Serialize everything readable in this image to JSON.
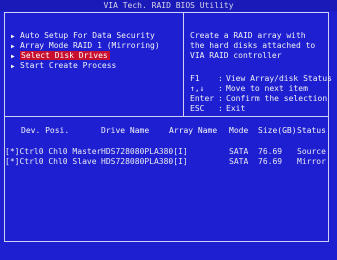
{
  "title": "VIA Tech. RAID BIOS Utility",
  "menu": {
    "items": [
      {
        "label": "Auto Setup For Data Security",
        "selected": false
      },
      {
        "label": "Array Mode RAID 1 (Mirroring)",
        "selected": false
      },
      {
        "label": "Select Disk Drives",
        "selected": true
      },
      {
        "label": "Start Create Process",
        "selected": false
      }
    ],
    "bullet_icon": "triangle-right-icon",
    "highlight_color": "#c8102e"
  },
  "help": {
    "lines": [
      "Create a RAID array with",
      "the hard disks attached to",
      "VIA RAID controller"
    ]
  },
  "keys": [
    {
      "key": "F1",
      "desc": "View Array/disk Status"
    },
    {
      "key": "↑,↓",
      "desc": "Move to next item"
    },
    {
      "key": "Enter",
      "desc": "Confirm the selection"
    },
    {
      "key": "ESC",
      "desc": "Exit"
    }
  ],
  "table": {
    "headers": {
      "dev": "Dev. Posi.",
      "drive": "Drive Name",
      "array": "Array Name",
      "mode": "Mode",
      "size": "Size(GB)",
      "status": "Status"
    },
    "rows": [
      {
        "dev": "[*]Ctrl0 Chl0 Master",
        "drive": "HDS728080PLA380[I]",
        "array": "",
        "mode": "SATA",
        "size": "76.69",
        "status": "Source"
      },
      {
        "dev": "[*]Ctrl0 Chl0 Slave",
        "drive": "HDS728080PLA380[I]",
        "array": "",
        "mode": "SATA",
        "size": "76.69",
        "status": "Mirror"
      }
    ]
  },
  "colors": {
    "background": "#1d1fd0",
    "text": "#e6e6f0",
    "selection": "#c8102e"
  }
}
